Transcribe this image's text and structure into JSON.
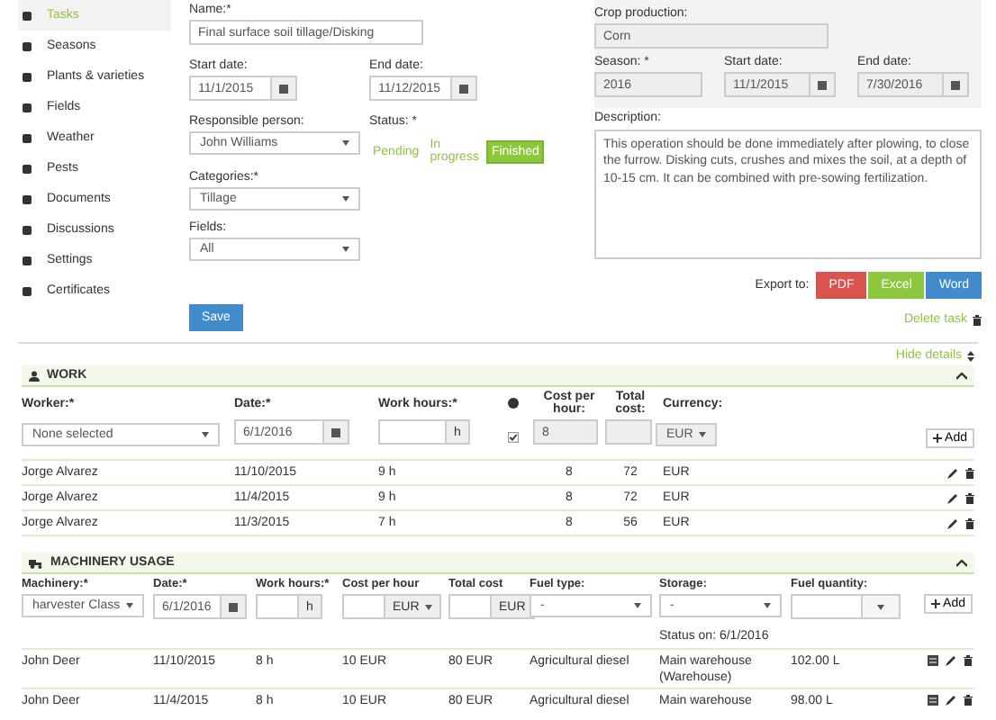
{
  "sidebar": {
    "items": [
      {
        "label": "Tasks",
        "selected": true
      },
      {
        "label": "Seasons",
        "selected": false
      },
      {
        "label": "Plants & varieties",
        "selected": false
      },
      {
        "label": "Fields",
        "selected": false
      },
      {
        "label": "Weather",
        "selected": false
      },
      {
        "label": "Pests",
        "selected": false
      },
      {
        "label": "Documents",
        "selected": false
      },
      {
        "label": "Discussions",
        "selected": false
      },
      {
        "label": "Settings",
        "selected": false
      },
      {
        "label": "Certificates",
        "selected": false
      }
    ]
  },
  "task_form": {
    "name": {
      "label": "Name:*",
      "value": "Final surface soil tillage/Disking"
    },
    "start_date": {
      "label": "Start date:",
      "value": "11/1/2015"
    },
    "end_date": {
      "label": "End date:",
      "value": "11/12/2015"
    },
    "responsible_person": {
      "label": "Responsible person:",
      "value": "John Williams"
    },
    "status": {
      "label": "Status: *",
      "options": [
        {
          "label": "Pending",
          "selected": false
        },
        {
          "label": "In progress",
          "selected": false
        },
        {
          "label": "Finished",
          "selected": true
        }
      ]
    },
    "categories": {
      "label": "Categories:*",
      "value": "Tillage"
    },
    "fields": {
      "label": "Fields:",
      "value": "All"
    },
    "save_button": "Save"
  },
  "crop_panel": {
    "crop_production": {
      "label": "Crop production:",
      "value": "Corn"
    },
    "season": {
      "label": "Season: *",
      "value": "2016"
    },
    "start_date": {
      "label": "Start date:",
      "value": "11/1/2015"
    },
    "end_date": {
      "label": "End date:",
      "value": "7/30/2016"
    }
  },
  "description": {
    "label": "Description:",
    "value": "This operation should be done immediately after plowing, to close the furrow. Disking cuts, crushes and mixes the soil, at a depth of 10-15 cm. It can be combined with pre-sowing fertilization."
  },
  "export": {
    "label": "Export to:",
    "buttons": [
      {
        "label": "PDF",
        "color": "#d9534f"
      },
      {
        "label": "Excel",
        "color": "#8dc63f"
      },
      {
        "label": "Word",
        "color": "#428bca"
      }
    ]
  },
  "delete_task": "Delete task",
  "hide_details": "Hide details",
  "work": {
    "title": "WORK",
    "columns": [
      "Worker:*",
      "Date:*",
      "Work hours:*",
      "Cost per hour:",
      "Total cost:",
      "Currency:"
    ],
    "new_row": {
      "worker": "None selected",
      "date": "6/1/2016",
      "hours_unit": "h",
      "checked": true,
      "cost_per_hour": "8",
      "currency": "EUR",
      "add": "Add"
    },
    "rows": [
      {
        "worker": "Jorge Alvarez",
        "date": "11/10/2015",
        "hours": "9 h",
        "cost_per_hour": "8",
        "total_cost": "72",
        "currency": "EUR"
      },
      {
        "worker": "Jorge Alvarez",
        "date": "11/4/2015",
        "hours": "9 h",
        "cost_per_hour": "8",
        "total_cost": "72",
        "currency": "EUR"
      },
      {
        "worker": "Jorge Alvarez",
        "date": "11/3/2015",
        "hours": "7 h",
        "cost_per_hour": "8",
        "total_cost": "56",
        "currency": "EUR"
      }
    ]
  },
  "machinery": {
    "title": "MACHINERY USAGE",
    "columns": [
      "Machinery:*",
      "Date:*",
      "Work hours:*",
      "Cost per hour",
      "Total cost",
      "Fuel type:",
      "Storage:",
      "Fuel quantity:"
    ],
    "new_row": {
      "machinery": "harvester Class",
      "date": "6/1/2016",
      "hours_unit": "h",
      "cost_currency": "EUR",
      "total_currency": "EUR",
      "fuel_type": "-",
      "storage": "-",
      "storage_status": "Status on: 6/1/2016",
      "add": "Add"
    },
    "rows": [
      {
        "machinery": "John Deer",
        "date": "11/10/2015",
        "hours": "8 h",
        "cost_per_hour": "10 EUR",
        "total_cost": "80 EUR",
        "fuel_type": "Agricultural diesel",
        "storage": "Main warehouse (Warehouse)",
        "fuel_quantity": "102.00 L"
      },
      {
        "machinery": "John Deer",
        "date": "11/4/2015",
        "hours": "8 h",
        "cost_per_hour": "10 EUR",
        "total_cost": "80 EUR",
        "fuel_type": "Agricultural diesel",
        "storage": "Main warehouse",
        "fuel_quantity": "98.00 L"
      }
    ]
  }
}
